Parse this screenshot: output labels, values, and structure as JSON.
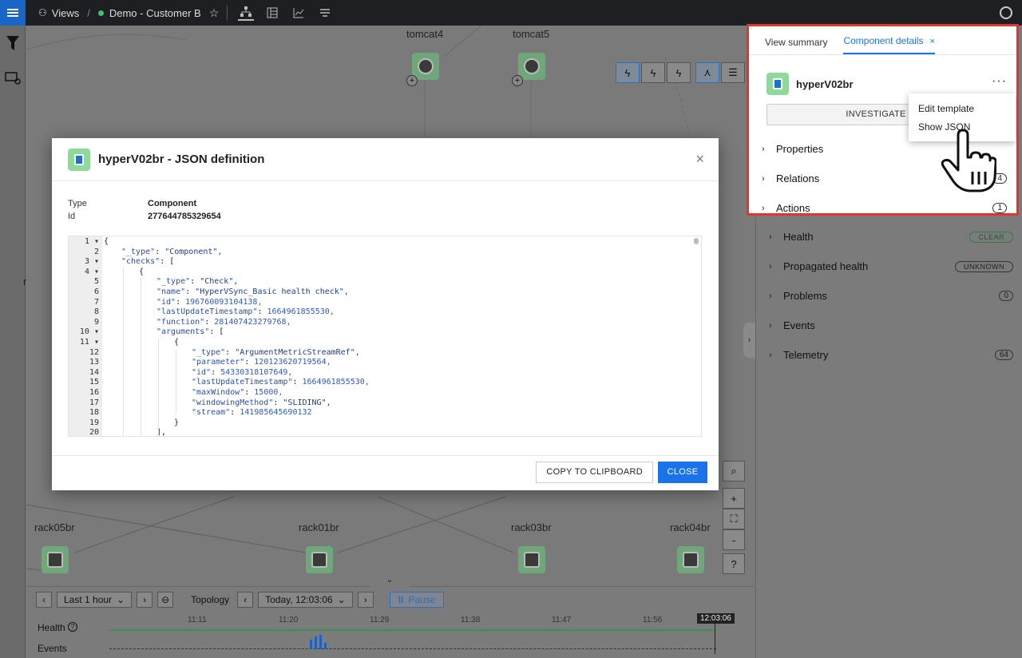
{
  "topbar": {
    "views_label": "Views",
    "view_name": "Demo - Customer B"
  },
  "canvas": {
    "nodes_top": [
      "tomcat4",
      "tomcat5"
    ],
    "nodes_bottom": [
      "rack05br",
      "rack01br",
      "rack03br",
      "rack04br"
    ],
    "partial_label": "r"
  },
  "zoom": {
    "search": "⌕",
    "zoom_in": "+",
    "fit": "⛶",
    "zoom_out": "-",
    "help": "?"
  },
  "timeline": {
    "range_label": "Last 1 hour",
    "mode_label": "Topology",
    "time_label": "Today, 12:03:06",
    "pause_label": "Pause",
    "health_label": "Health",
    "events_label": "Events",
    "ticks": [
      "11:11",
      "11:20",
      "11:29",
      "11:38",
      "11:47",
      "11:56"
    ],
    "now": "12:03:06"
  },
  "panel": {
    "tab_summary": "View summary",
    "tab_details": "Component details",
    "tab_close": "×",
    "component_name": "hyperV02br",
    "menu_dots": "···",
    "investigate_label": "INVESTIGATE IN S",
    "context_menu": [
      "Edit template",
      "Show JSON"
    ],
    "sections_top": [
      {
        "label": "Properties"
      },
      {
        "label": "Relations",
        "count": "4"
      },
      {
        "label": "Actions",
        "count": "1"
      }
    ],
    "health": {
      "label": "Health",
      "badge": "CLEAR"
    },
    "propagated": {
      "label": "Propagated health",
      "badge": "UNKNOWN"
    },
    "problems": {
      "label": "Problems",
      "count": "0"
    },
    "events": {
      "label": "Events"
    },
    "telemetry": {
      "label": "Telemetry",
      "count": "64"
    }
  },
  "modal": {
    "title": "hyperV02br - JSON definition",
    "close": "×",
    "type_key": "Type",
    "type_val": "Component",
    "id_key": "Id",
    "id_val": "277644785329654",
    "copy_label": "COPY TO CLIPBOARD",
    "close_label": "CLOSE",
    "code_lines": [
      {
        "n": "1",
        "fold": true,
        "indent": 0,
        "text": "{"
      },
      {
        "n": "2",
        "indent": 1,
        "text": "\"_type\": \"Component\","
      },
      {
        "n": "3",
        "fold": true,
        "indent": 1,
        "text": "\"checks\": ["
      },
      {
        "n": "4",
        "fold": true,
        "indent": 2,
        "text": "{"
      },
      {
        "n": "5",
        "indent": 3,
        "text": "\"_type\": \"Check\","
      },
      {
        "n": "6",
        "indent": 3,
        "text": "\"name\": \"HyperVSync_Basic health check\","
      },
      {
        "n": "7",
        "indent": 3,
        "text": "\"id\": 196760093104138,"
      },
      {
        "n": "8",
        "indent": 3,
        "text": "\"lastUpdateTimestamp\": 1664961855530,"
      },
      {
        "n": "9",
        "indent": 3,
        "text": "\"function\": 281407423279768,"
      },
      {
        "n": "10",
        "fold": true,
        "indent": 3,
        "text": "\"arguments\": ["
      },
      {
        "n": "11",
        "fold": true,
        "indent": 4,
        "text": "{"
      },
      {
        "n": "12",
        "indent": 5,
        "text": "\"_type\": \"ArgumentMetricStreamRef\","
      },
      {
        "n": "13",
        "indent": 5,
        "text": "\"parameter\": 120123620719564,"
      },
      {
        "n": "14",
        "indent": 5,
        "text": "\"id\": 54330318107649,"
      },
      {
        "n": "15",
        "indent": 5,
        "text": "\"lastUpdateTimestamp\": 1664961855530,"
      },
      {
        "n": "16",
        "indent": 5,
        "text": "\"maxWindow\": 15000,"
      },
      {
        "n": "17",
        "indent": 5,
        "text": "\"windowingMethod\": \"SLIDING\","
      },
      {
        "n": "18",
        "indent": 5,
        "text": "\"stream\": 141985645690132"
      },
      {
        "n": "19",
        "indent": 4,
        "text": "}"
      },
      {
        "n": "20",
        "indent": 3,
        "text": "],"
      }
    ]
  },
  "colors": {
    "accent": "#1a73e8",
    "highlight_border": "#e3342f",
    "node_green": "#8fd99a"
  }
}
